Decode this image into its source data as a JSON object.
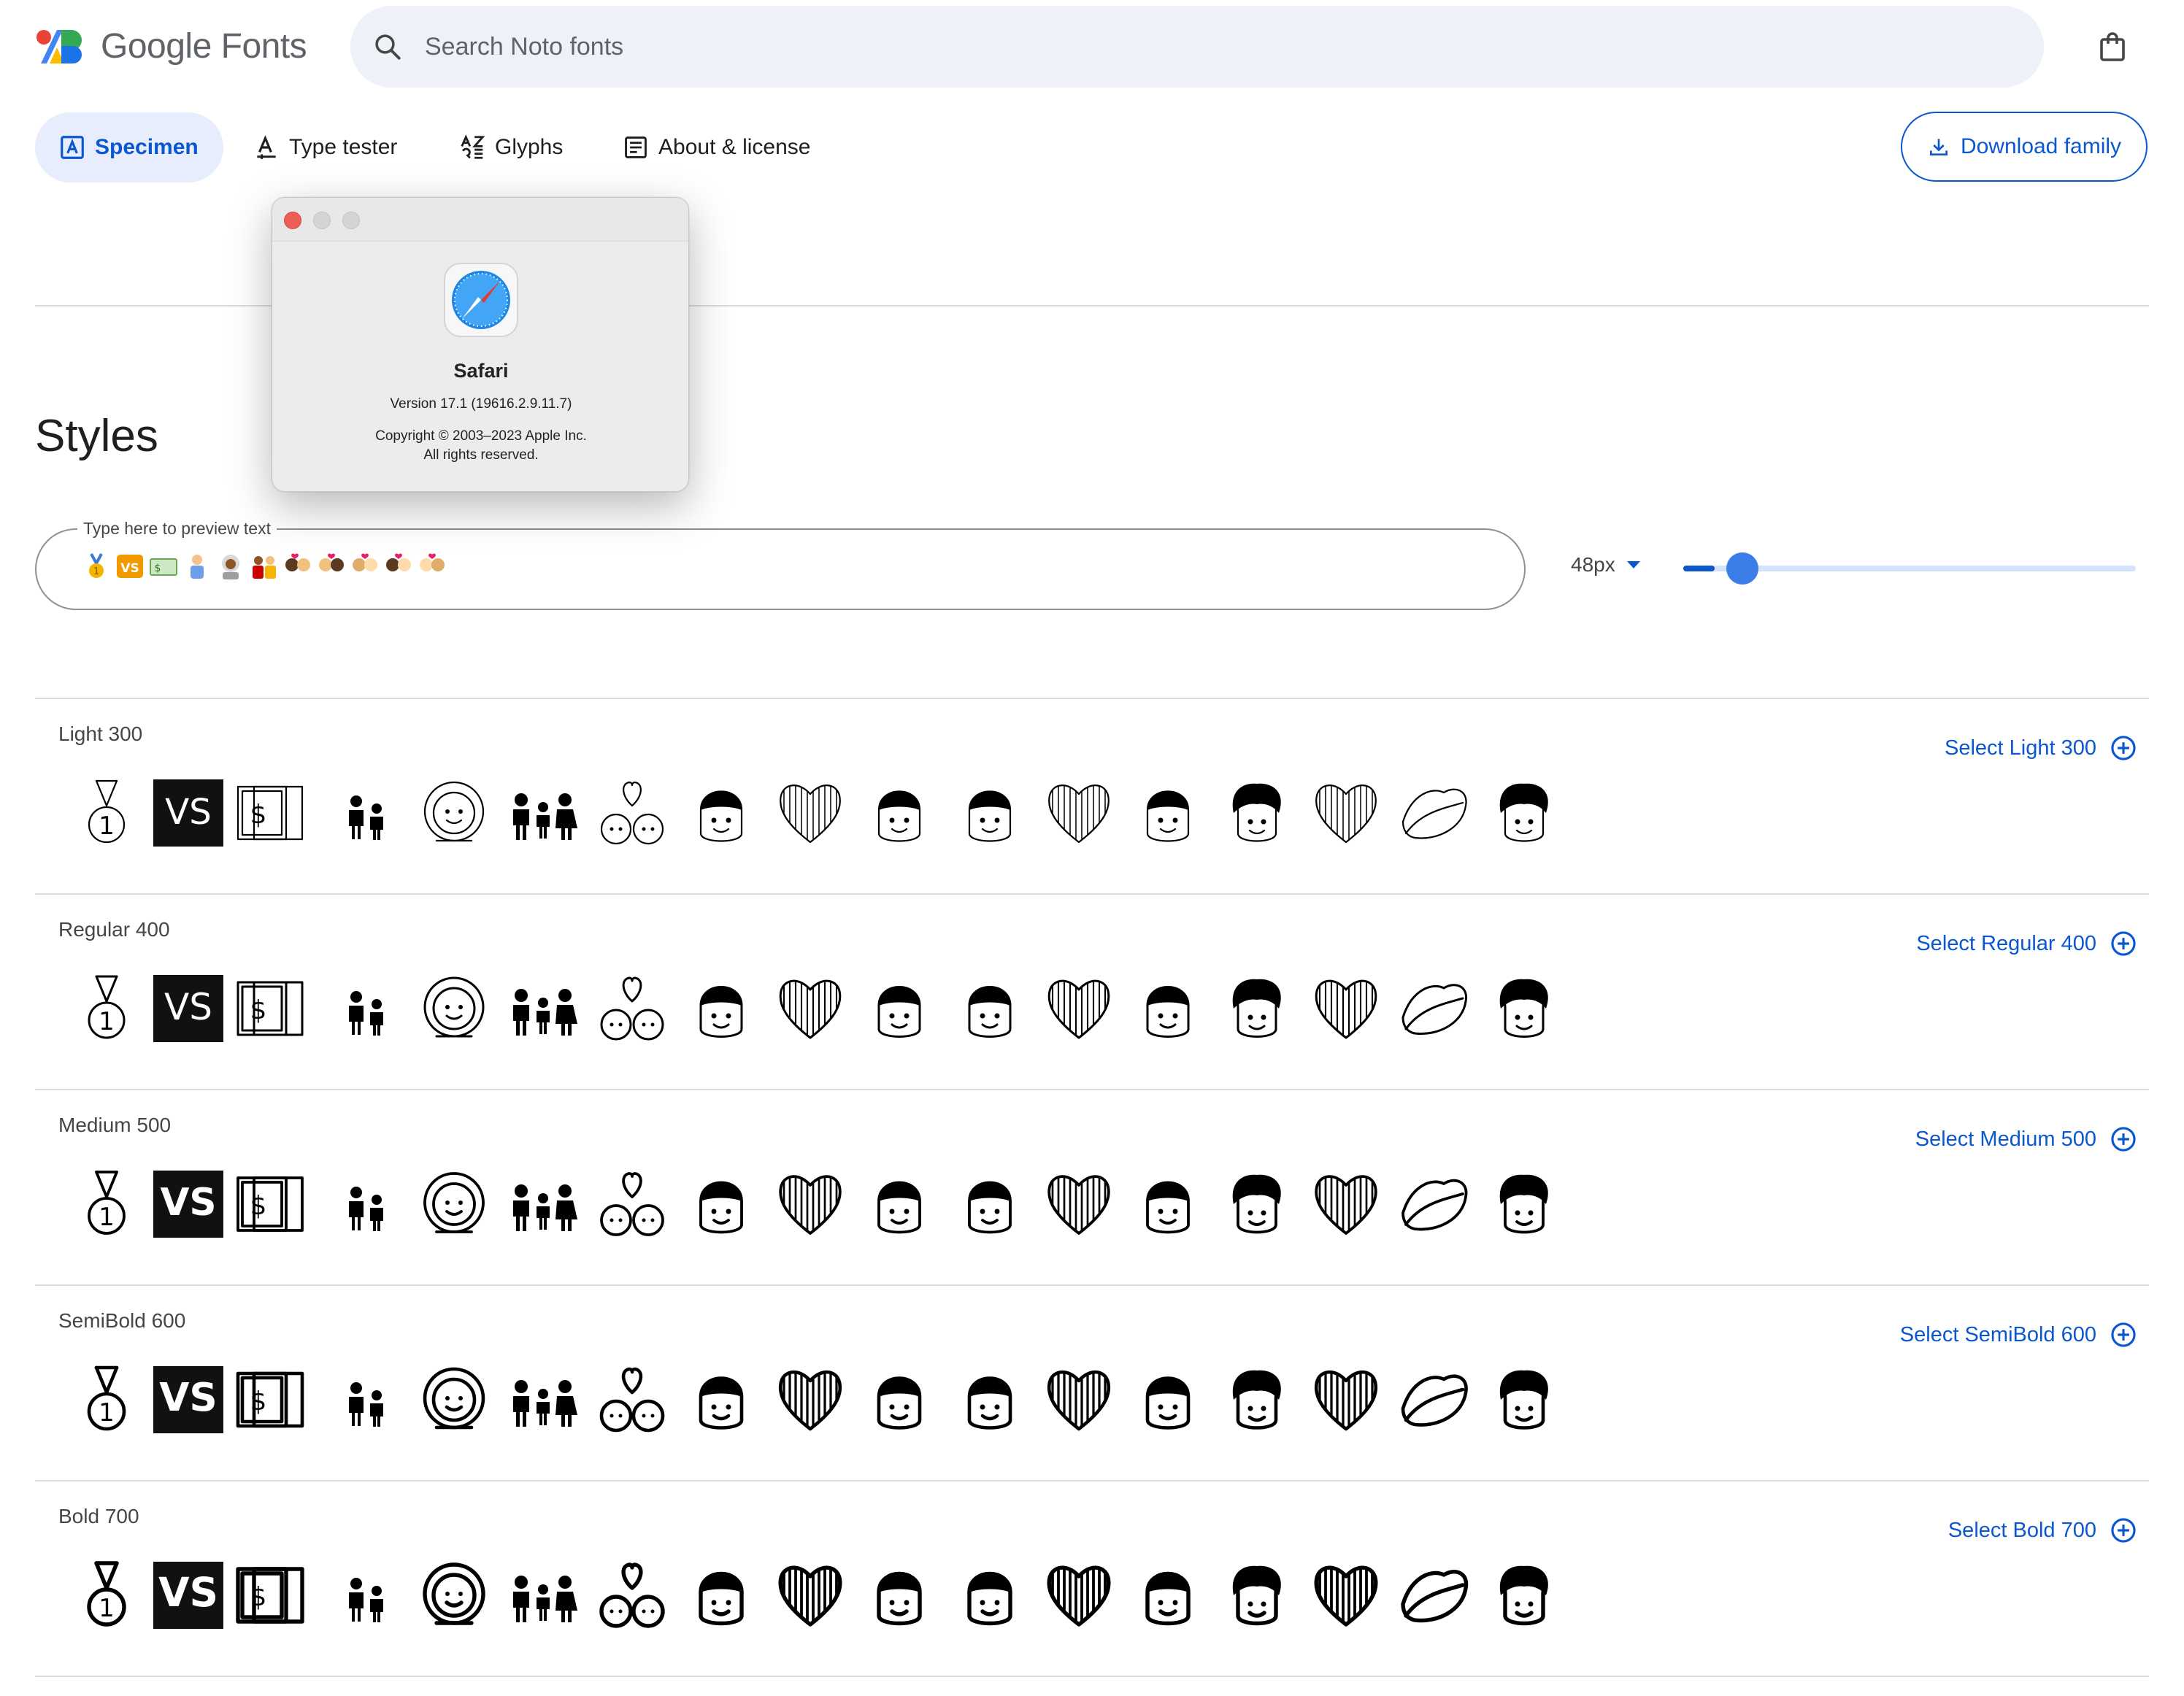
{
  "header": {
    "logo_text": "Google Fonts",
    "search_placeholder": "Search Noto fonts"
  },
  "tabs": [
    {
      "label": "Specimen",
      "icon": "specimen-icon",
      "active": true
    },
    {
      "label": "Type tester",
      "icon": "type-tester-icon",
      "active": false
    },
    {
      "label": "Glyphs",
      "icon": "glyphs-icon",
      "active": false
    },
    {
      "label": "About & license",
      "icon": "article-icon",
      "active": false
    }
  ],
  "download_label": "Download family",
  "styles": {
    "title": "Styles",
    "preview_label": "Type here to preview text",
    "size_label": "48px",
    "slider_value_fraction": 0.07
  },
  "rows": [
    {
      "label": "Light 300",
      "select_label": "Select Light 300"
    },
    {
      "label": "Regular 400",
      "select_label": "Select Regular 400"
    },
    {
      "label": "Medium 500",
      "select_label": "Select Medium 500"
    },
    {
      "label": "SemiBold 600",
      "select_label": "Select SemiBold 600"
    },
    {
      "label": "Bold 700",
      "select_label": "Select Bold 700"
    }
  ],
  "glyph_icons": [
    "medal-icon",
    "vs-button-icon",
    "money-icon",
    "kids-icon",
    "astronaut-icon",
    "family-icon",
    "couple-heart-icon",
    "face-icon",
    "striped-heart-icon",
    "face-icon",
    "face-icon",
    "striped-heart-icon",
    "face-icon",
    "curly-face-icon",
    "striped-heart-icon",
    "lips-icon",
    "curly-face-icon"
  ],
  "about_window": {
    "app_name": "Safari",
    "version": "Version 17.1 (19616.2.9.11.7)",
    "copyright_line1": "Copyright © 2003–2023 Apple Inc.",
    "copyright_line2": "All rights reserved."
  },
  "colors": {
    "accent": "#0b57d0",
    "active_tab_bg": "#e7edfc",
    "search_bg": "#eef1f7",
    "divider": "#dadce0"
  }
}
